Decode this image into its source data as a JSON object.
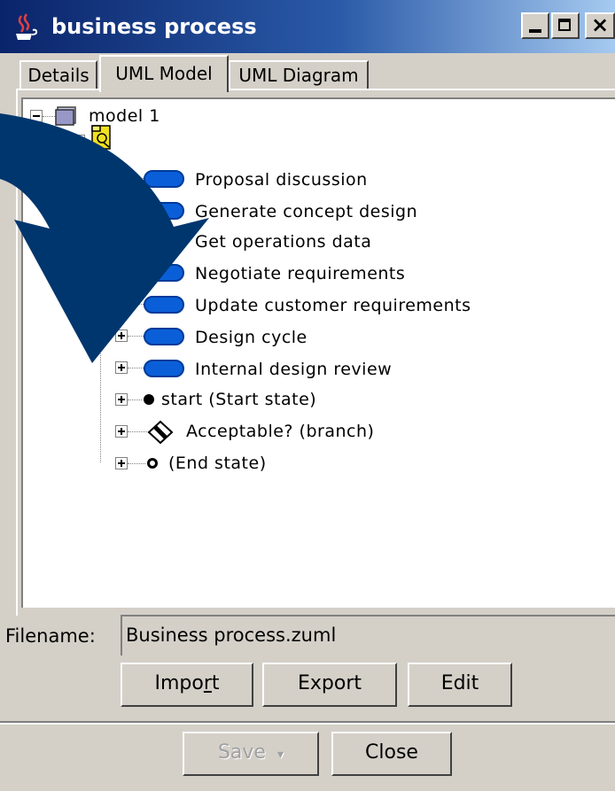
{
  "window": {
    "title": "business process"
  },
  "tabs": {
    "details": "Details",
    "uml_model": "UML Model",
    "uml_diagram": "UML Diagram"
  },
  "tree": {
    "root": "model 1",
    "items": [
      "Proposal discussion",
      "Generate concept design",
      "Get operations data",
      "Negotiate requirements",
      "Update customer requirements",
      "Design cycle",
      "Internal design review",
      "start (Start state)",
      "Acceptable? (branch)",
      "(End state)"
    ]
  },
  "filename": {
    "label": "Filename:",
    "value": "Business process.zuml"
  },
  "buttons": {
    "import_pre": "Impo",
    "import_u": "r",
    "import_post": "t",
    "export": "Export",
    "edit": "Edit",
    "save": "Save",
    "close": "Close"
  },
  "colors": {
    "titlebar": "#0a246a",
    "activity": "#0a5fd8",
    "arrow": "#00366e"
  }
}
